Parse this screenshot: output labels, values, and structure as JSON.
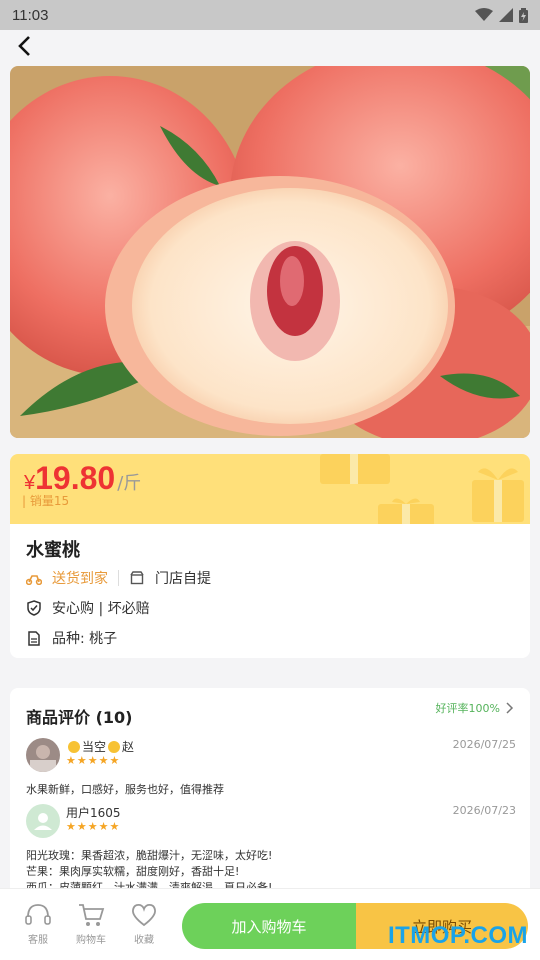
{
  "status_bar": {
    "time": "11:03"
  },
  "product": {
    "currency": "¥",
    "price": "19.80",
    "unit": "/斤",
    "sales": "| 销量15",
    "name": "水蜜桃",
    "delivery": "送货到家",
    "pickup": "门店自提",
    "guarantee": "安心购 | 坏必赔",
    "variety": "品种: 桃子"
  },
  "reviews": {
    "title": "商品评价 (10)",
    "good_rate": "好评率100%",
    "items": [
      {
        "user": "当空",
        "user_suffix": "赵",
        "stars": "★★★★★",
        "date": "2026/07/25",
        "text": "水果新鲜，口感好，服务也好，值得推荐"
      },
      {
        "user": "用户1605",
        "stars": "★★★★★",
        "date": "2026/07/23",
        "text": "阳光玫瑰：果香超浓，脆甜爆汁，无涩味，太好吃!\n芒果：果肉厚实软糯，甜度刚好，香甜十足!\n西瓜：皮薄颗红，汁水满满，清爽解渴，夏日必备!"
      }
    ]
  },
  "bottom_bar": {
    "service": "客服",
    "cart": "购物车",
    "favorite": "收藏",
    "add_to_cart": "加入购物车",
    "buy_now": "立即购买"
  },
  "watermark": "ITMOP.COM",
  "colors": {
    "price_red": "#e33333",
    "cart_green": "#6dd15a",
    "buy_yellow": "#f8c445",
    "banner_yellow": "#ffe07a"
  }
}
